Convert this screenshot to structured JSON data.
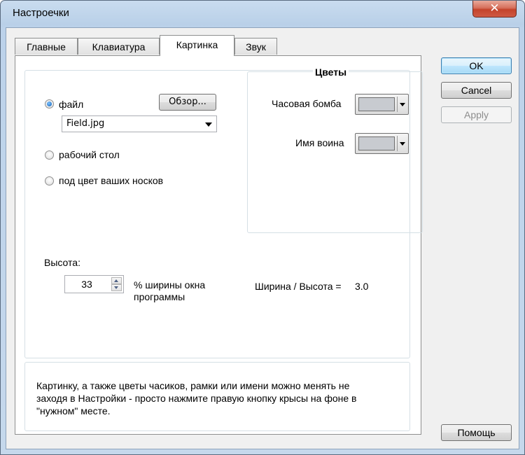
{
  "window": {
    "title": "Настроечки",
    "close_glyph": "✕"
  },
  "tabs": [
    {
      "label": "Главные"
    },
    {
      "label": "Клавиатура"
    },
    {
      "label": "Картинка"
    },
    {
      "label": "Звук"
    }
  ],
  "background": {
    "options": [
      {
        "label": "файл",
        "selected": true
      },
      {
        "label": "рабочий стол",
        "selected": false
      },
      {
        "label": "под цвет ваших носков",
        "selected": false
      }
    ],
    "browse_label": "Обзор...",
    "file_value": "Field.jpg"
  },
  "colors": {
    "title": "Цветы",
    "clock_bomb_label": "Часовая бомба",
    "clock_bomb_color": "#c8cbd0",
    "warrior_name_label": "Имя воина",
    "warrior_name_color": "#c8cbd0"
  },
  "height": {
    "label": "Высота:",
    "value": "33",
    "unit_label_line1": "% ширины окна",
    "unit_label_line2": "программы",
    "ratio_label": "Ширина / Высота =",
    "ratio_value": "3.0"
  },
  "hint": {
    "line1": "Картинку, а также цветы часиков, рамки или имени можно менять не",
    "line2": "заходя в Настройки - просто нажмите правую кнопку крысы на фоне в",
    "line3": "\"нужном\" месте."
  },
  "buttons": {
    "ok": "OK",
    "cancel": "Cancel",
    "apply": "Apply",
    "help": "Помощь"
  }
}
